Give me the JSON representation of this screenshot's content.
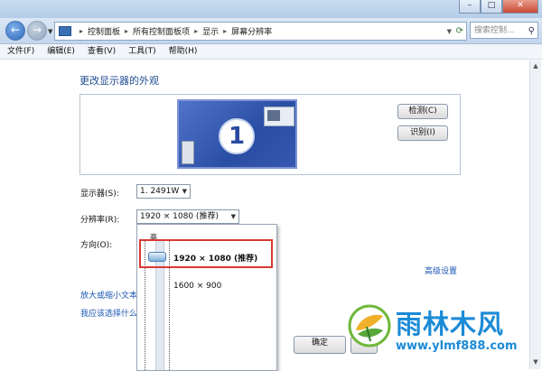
{
  "window": {
    "minimize_label": "–",
    "maximize_label": "□",
    "close_label": "✕"
  },
  "navigation": {
    "back_arrow": "←",
    "forward_arrow": "→",
    "address_segments": [
      "控制面板",
      "所有控制面板项",
      "显示",
      "屏幕分辨率"
    ],
    "search_placeholder": "搜索控制...",
    "icons": {
      "back": "back-arrow-icon",
      "forward": "forward-arrow-icon",
      "search": "search-icon",
      "refresh": "refresh-icon"
    }
  },
  "menu": {
    "items": [
      "文件(F)",
      "编辑(E)",
      "查看(V)",
      "工具(T)",
      "帮助(H)"
    ]
  },
  "page": {
    "heading": "更改显示器的外观",
    "monitor_number": "1",
    "detect_button": "检测(C)",
    "identify_button": "识别(I)",
    "display_label": "显示器(S):",
    "display_value": "1. 2491W",
    "resolution_label": "分辨率(R):",
    "resolution_value": "1920 × 1080 (推荐)",
    "orientation_label": "方向(O):",
    "advanced_link": "高级设置",
    "link_text_size": "放大或缩小文本",
    "link_which_settings": "我应该选择什么"
  },
  "resolution_dropdown": {
    "high_label": "高",
    "options": [
      "1920 × 1080 (推荐)",
      "1600 × 900"
    ],
    "selected_index": 0
  },
  "footer": {
    "ok_button": "确定"
  },
  "watermark": {
    "title": "雨林木风",
    "url": "www.ylmf888.com",
    "accent_color": "#1c8bd6"
  },
  "colors": {
    "highlight_border": "#d93a33",
    "link": "#1b57b3",
    "heading": "#1e4c8f"
  }
}
